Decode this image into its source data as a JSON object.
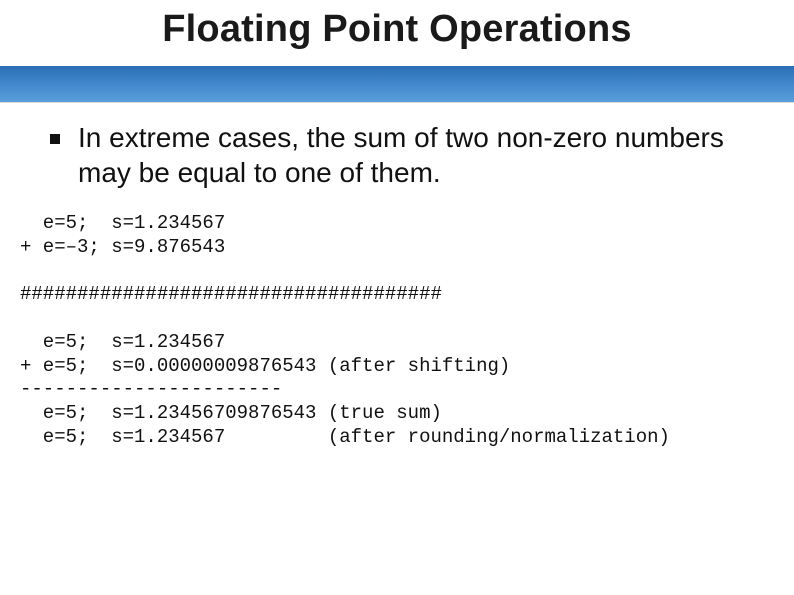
{
  "title": "Floating Point Operations",
  "bullet": "In extreme cases, the sum of two non-zero numbers may be equal to one of them.",
  "code": {
    "line1": "  e=5;  s=1.234567",
    "line2": "+ e=–3; s=9.876543",
    "sep1": "#####################################",
    "line3": "  e=5;  s=1.234567",
    "line4": "+ e=5;  s=0.00000009876543 (after shifting)",
    "dash": "-----------------------",
    "line5": "  e=5;  s=1.23456709876543 (true sum)",
    "line6": "  e=5;  s=1.234567         (after rounding/normalization)"
  }
}
